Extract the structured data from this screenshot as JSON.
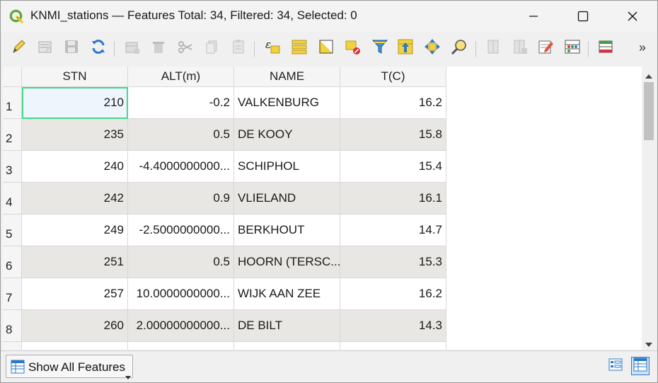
{
  "window": {
    "title": "KNMI_stations — Features Total: 34, Filtered: 34, Selected: 0"
  },
  "icons": {
    "app": "qgis-logo-icon",
    "minimize": "minimize-icon",
    "maximize": "maximize-icon",
    "close": "close-icon",
    "more": "chevron-double-right-icon"
  },
  "toolbar": {
    "more_label": "»",
    "buttons": [
      "toggle-editing",
      "multi-edit",
      "save-edits",
      "reload",
      "add-feature",
      "delete-feature",
      "cut",
      "copy",
      "paste",
      "select-by-expression",
      "select-all",
      "invert-selection",
      "deselect-all",
      "filter-select",
      "move-selection-top",
      "pan-to-selected",
      "zoom-to-selected",
      "new-field",
      "delete-field",
      "open-field-calculator",
      "conditional-formatting",
      "dock-table"
    ]
  },
  "table": {
    "headers": [
      "STN",
      "ALT(m)",
      "NAME",
      "T(C)"
    ],
    "rows": [
      {
        "num": "1",
        "stn": "210",
        "alt": "-0.2",
        "name": "VALKENBURG",
        "t": "16.2"
      },
      {
        "num": "2",
        "stn": "235",
        "alt": "0.5",
        "name": "DE KOOY",
        "t": "15.8"
      },
      {
        "num": "3",
        "stn": "240",
        "alt": "-4.4000000000...",
        "name": "SCHIPHOL",
        "t": "15.4"
      },
      {
        "num": "4",
        "stn": "242",
        "alt": "0.9",
        "name": "VLIELAND",
        "t": "16.1"
      },
      {
        "num": "5",
        "stn": "249",
        "alt": "-2.5000000000...",
        "name": "BERKHOUT",
        "t": "14.7"
      },
      {
        "num": "6",
        "stn": "251",
        "alt": "0.5",
        "name": "HOORN (TERSC...",
        "t": "15.3"
      },
      {
        "num": "7",
        "stn": "257",
        "alt": "10.0000000000...",
        "name": "WIJK AAN ZEE",
        "t": "16.2"
      },
      {
        "num": "8",
        "stn": "260",
        "alt": "2.00000000000...",
        "name": "DE BILT",
        "t": "14.3"
      }
    ]
  },
  "bottom": {
    "filter_label": "Show All Features"
  },
  "colors": {
    "selection_border": "#45d98a",
    "alt_row": "#e9e7e3"
  }
}
